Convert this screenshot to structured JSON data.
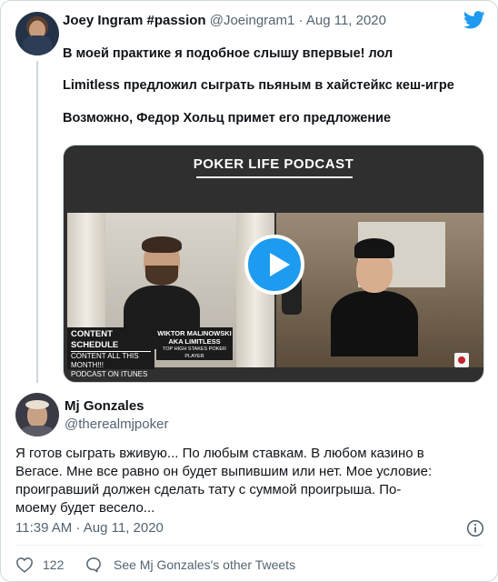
{
  "quoted_tweet": {
    "author_name": "Joey Ingram #passion",
    "author_handle": "@Joeingram1",
    "separator": "·",
    "date": "Aug 11, 2020",
    "lines": [
      "В моей практике я подобное слышу впервые! лол",
      "Limitless предложил сыграть пьяным в хайстейкс кеш-игре",
      "Возможно, Федор Хольц примет его предложение"
    ],
    "media": {
      "title": "POKER LIFE PODCAST",
      "schedule_title": "CONTENT SCHEDULE",
      "schedule_lines": [
        "CONTENT ALL THIS MONTH!!!",
        "PODCAST ON ITUNES"
      ],
      "guest_name": "WIKTOR MALINOWSKI",
      "guest_alias": "AKA LIMITLESS",
      "guest_desc": "TOP HIGH STAKES POKER PLAYER",
      "play_icon": "play-icon"
    }
  },
  "tweet": {
    "author_name": "Mj Gonzales",
    "author_handle": "@therealmjpoker",
    "lines": [
      "Я готов сыграть вживую... По любым ставкам. В любом казино в",
      "Вегасе. Мне все равно он будет выпившим или нет. Мое условие:",
      "проигравший должен сделать тату с суммой проигрыша. По-",
      "моему будет весело..."
    ],
    "timestamp": "11:39 AM · Aug 11, 2020",
    "like_count": "122",
    "see_more": "See Mj Gonzales's other Tweets"
  },
  "colors": {
    "accent": "#1d9bf0",
    "text": "#0f1419",
    "muted": "#536471",
    "border": "#cfd9de"
  },
  "icons": [
    "twitter-logo-icon",
    "play-icon",
    "info-icon",
    "heart-icon",
    "comment-icon"
  ]
}
